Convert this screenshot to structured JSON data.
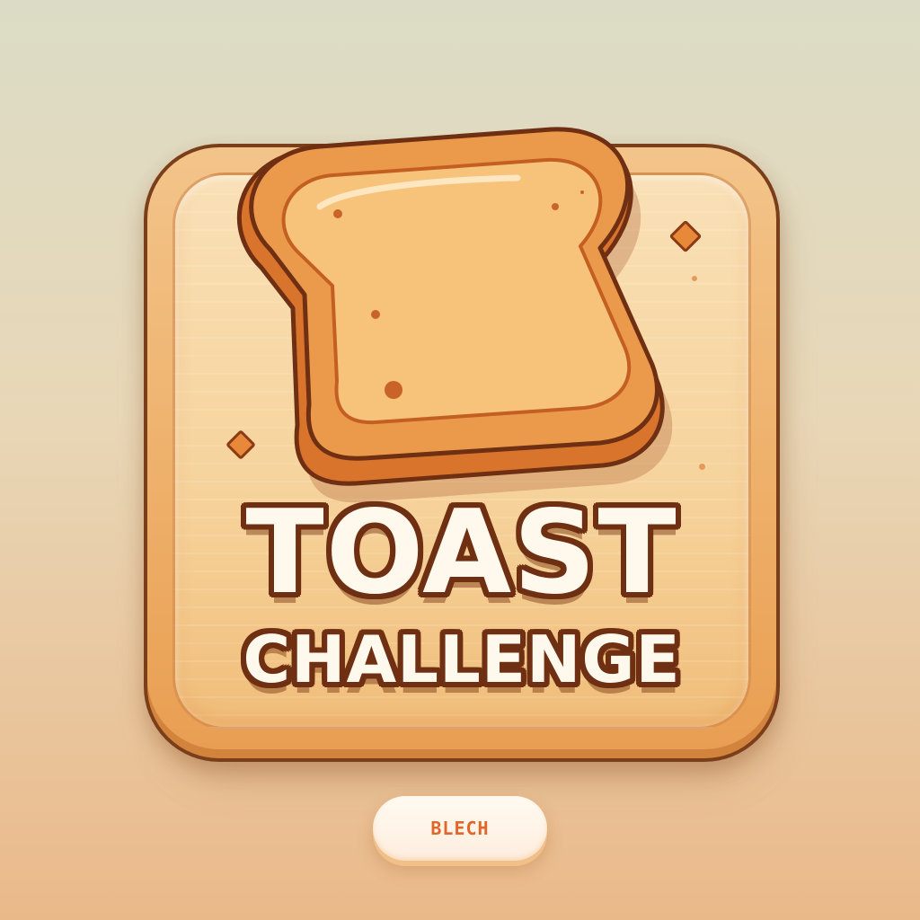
{
  "title": {
    "line1": "TOAST",
    "line2": "CHALLENGE"
  },
  "button": {
    "label": "BLECH"
  },
  "icons": {
    "main": "toast-bread-slice-icon",
    "crumbs": "crumb-icon"
  },
  "colors": {
    "background_top": "#dcdcc6",
    "background_bottom": "#eab98a",
    "tile": "#f3c48a",
    "outline": "#6e2f12",
    "crust": "#e8893a",
    "bread": "#f7c27a",
    "title_text": "#fff8ec",
    "button_text": "#e2662a"
  }
}
